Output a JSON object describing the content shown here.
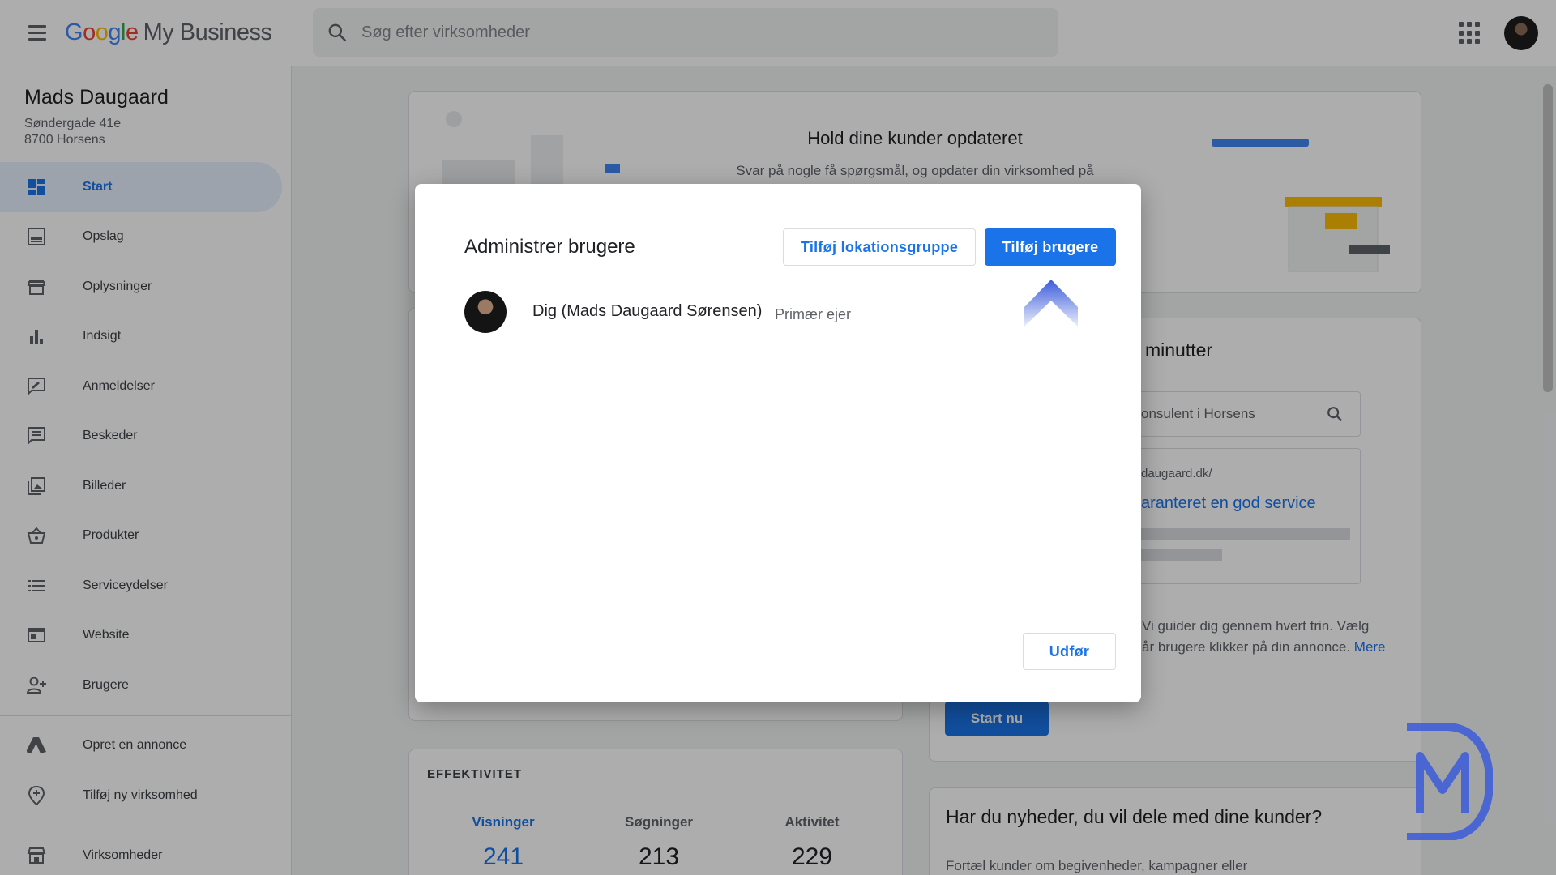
{
  "header": {
    "logo_google": [
      "G",
      "o",
      "o",
      "g",
      "l",
      "e"
    ],
    "logo_rest": "My Business",
    "search_placeholder": "Søg efter virksomheder"
  },
  "business": {
    "name": "Mads Daugaard",
    "address_line1": "Søndergade 41e",
    "address_line2": "8700 Horsens"
  },
  "sidebar": {
    "items": [
      {
        "label": "Start",
        "icon": "dashboard-icon",
        "active": true
      },
      {
        "label": "Opslag",
        "icon": "post-icon"
      },
      {
        "label": "Oplysninger",
        "icon": "store-icon"
      },
      {
        "label": "Indsigt",
        "icon": "bar-chart-icon"
      },
      {
        "label": "Anmeldelser",
        "icon": "review-icon"
      },
      {
        "label": "Beskeder",
        "icon": "message-icon"
      },
      {
        "label": "Billeder",
        "icon": "photos-icon"
      },
      {
        "label": "Produkter",
        "icon": "basket-icon"
      },
      {
        "label": "Serviceydelser",
        "icon": "list-icon"
      },
      {
        "label": "Website",
        "icon": "website-icon"
      },
      {
        "label": "Brugere",
        "icon": "add-user-icon"
      }
    ],
    "secondary": [
      {
        "label": "Opret en annonce",
        "icon": "google-ads-icon"
      },
      {
        "label": "Tilføj ny virksomhed",
        "icon": "add-location-icon"
      }
    ],
    "tertiary": [
      {
        "label": "Virksomheder",
        "icon": "businesses-icon"
      }
    ]
  },
  "main": {
    "hero_title": "Hold dine kunder opdateret",
    "hero_subtitle": "Svar på nogle få spørgsmål, og opdater din virksomhed på",
    "ads_title_fragment": "minutter",
    "ads_search_fragment": "onsulent i Horsens",
    "ads_url_fragment": "daugaard.dk/",
    "ads_headline_fragment": "aranteret en god service",
    "ads_desc_line1": "Vi guider dig gennem hvert trin. Vælg",
    "ads_desc_line2": "år brugere klikker på din annonce.",
    "ads_more_link": "Mere",
    "start_button": "Start nu",
    "efficiency_title": "EFFEKTIVITET",
    "stats": [
      {
        "label": "Visninger",
        "value": "241"
      },
      {
        "label": "Søgninger",
        "value": "213"
      },
      {
        "label": "Aktivitet",
        "value": "229"
      }
    ],
    "news_title": "Har du nyheder, du vil dele med dine kunder?",
    "news_subtitle": "Fortæl kunder om begivenheder, kampagner eller"
  },
  "modal": {
    "title": "Administrer brugere",
    "add_location_group": "Tilføj lokationsgruppe",
    "add_users": "Tilføj brugere",
    "users": [
      {
        "name": "Dig (Mads Daugaard Sørensen)",
        "role": "Primær ejer"
      }
    ],
    "done_button": "Udfør"
  },
  "colors": {
    "accent": "#1a73e8",
    "active_bg": "#e8f0fe",
    "watermark": "#3b5bdb"
  }
}
